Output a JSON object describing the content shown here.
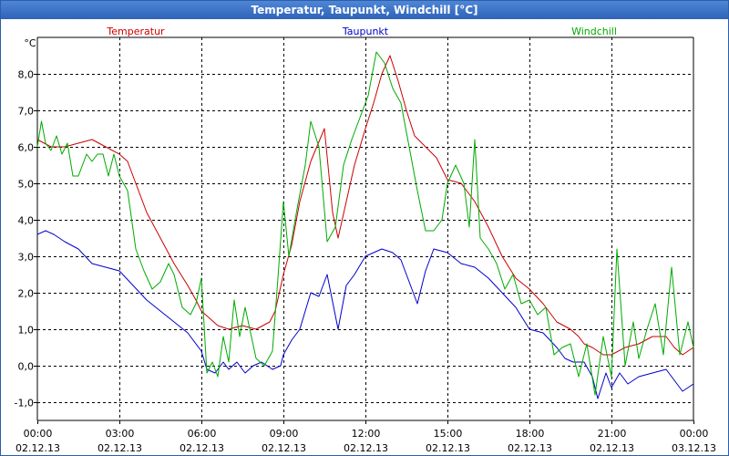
{
  "window": {
    "title": "Temperatur, Taupunkt, Windchill [°C]"
  },
  "chart_data": {
    "type": "line",
    "title": "Temperatur, Taupunkt, Windchill [°C]",
    "ylabel": "°C",
    "xlabel": "",
    "xlim_hours": [
      0,
      24
    ],
    "ylim": [
      -1.5,
      9.0
    ],
    "grid": true,
    "legend_placement": "top",
    "yticks": [
      {
        "value": 8,
        "label": "8,0"
      },
      {
        "value": 7,
        "label": "7,0"
      },
      {
        "value": 6,
        "label": "6,0"
      },
      {
        "value": 5,
        "label": "5,0"
      },
      {
        "value": 4,
        "label": "4,0"
      },
      {
        "value": 3,
        "label": "3,0"
      },
      {
        "value": 2,
        "label": "2,0"
      },
      {
        "value": 1,
        "label": "1,0"
      },
      {
        "value": 0,
        "label": "0,0"
      },
      {
        "value": -1,
        "label": "-1,0"
      }
    ],
    "xticks": [
      {
        "hour": 0,
        "time": "00:00",
        "date": "02.12.13"
      },
      {
        "hour": 3,
        "time": "03:00",
        "date": "02.12.13"
      },
      {
        "hour": 6,
        "time": "06:00",
        "date": "02.12.13"
      },
      {
        "hour": 9,
        "time": "09:00",
        "date": "02.12.13"
      },
      {
        "hour": 12,
        "time": "12:00",
        "date": "02.12.13"
      },
      {
        "hour": 15,
        "time": "15:00",
        "date": "02.12.13"
      },
      {
        "hour": 18,
        "time": "18:00",
        "date": "02.12.13"
      },
      {
        "hour": 21,
        "time": "21:00",
        "date": "02.12.13"
      },
      {
        "hour": 24,
        "time": "00:00",
        "date": "03.12.13"
      }
    ],
    "series": [
      {
        "name": "Temperatur",
        "color": "#cc0000",
        "points": [
          [
            0.0,
            6.2
          ],
          [
            0.5,
            6.0
          ],
          [
            1.0,
            6.0
          ],
          [
            1.5,
            6.1
          ],
          [
            2.0,
            6.2
          ],
          [
            2.5,
            6.0
          ],
          [
            3.0,
            5.8
          ],
          [
            3.3,
            5.6
          ],
          [
            3.6,
            5.0
          ],
          [
            4.0,
            4.2
          ],
          [
            4.5,
            3.5
          ],
          [
            5.0,
            2.8
          ],
          [
            5.5,
            2.2
          ],
          [
            5.8,
            1.8
          ],
          [
            6.0,
            1.5
          ],
          [
            6.3,
            1.3
          ],
          [
            6.6,
            1.1
          ],
          [
            7.0,
            1.0
          ],
          [
            7.5,
            1.1
          ],
          [
            8.0,
            1.0
          ],
          [
            8.5,
            1.2
          ],
          [
            8.7,
            1.5
          ],
          [
            9.0,
            2.5
          ],
          [
            9.3,
            3.3
          ],
          [
            9.6,
            4.5
          ],
          [
            10.0,
            5.6
          ],
          [
            10.5,
            6.5
          ],
          [
            10.8,
            4.2
          ],
          [
            11.0,
            3.5
          ],
          [
            11.3,
            4.5
          ],
          [
            11.6,
            5.5
          ],
          [
            12.0,
            6.5
          ],
          [
            12.3,
            7.2
          ],
          [
            12.6,
            8.0
          ],
          [
            12.9,
            8.5
          ],
          [
            13.2,
            7.8
          ],
          [
            13.5,
            7.0
          ],
          [
            13.8,
            6.3
          ],
          [
            14.2,
            6.0
          ],
          [
            14.6,
            5.7
          ],
          [
            15.0,
            5.1
          ],
          [
            15.5,
            5.0
          ],
          [
            16.0,
            4.5
          ],
          [
            16.5,
            3.8
          ],
          [
            17.0,
            3.0
          ],
          [
            17.5,
            2.4
          ],
          [
            18.0,
            2.1
          ],
          [
            18.5,
            1.7
          ],
          [
            19.0,
            1.2
          ],
          [
            19.5,
            1.0
          ],
          [
            19.8,
            0.8
          ],
          [
            20.0,
            0.6
          ],
          [
            20.3,
            0.5
          ],
          [
            20.7,
            0.3
          ],
          [
            21.0,
            0.3
          ],
          [
            21.5,
            0.5
          ],
          [
            22.0,
            0.6
          ],
          [
            22.5,
            0.8
          ],
          [
            23.0,
            0.8
          ],
          [
            23.3,
            0.5
          ],
          [
            23.6,
            0.3
          ],
          [
            24.0,
            0.5
          ]
        ]
      },
      {
        "name": "Taupunkt",
        "color": "#0000cc",
        "points": [
          [
            0.0,
            3.6
          ],
          [
            0.3,
            3.7
          ],
          [
            0.6,
            3.6
          ],
          [
            1.0,
            3.4
          ],
          [
            1.5,
            3.2
          ],
          [
            2.0,
            2.8
          ],
          [
            2.5,
            2.7
          ],
          [
            3.0,
            2.6
          ],
          [
            3.5,
            2.2
          ],
          [
            4.0,
            1.8
          ],
          [
            4.5,
            1.5
          ],
          [
            5.0,
            1.2
          ],
          [
            5.5,
            0.9
          ],
          [
            6.0,
            0.4
          ],
          [
            6.2,
            -0.1
          ],
          [
            6.5,
            -0.2
          ],
          [
            6.8,
            0.1
          ],
          [
            7.0,
            -0.1
          ],
          [
            7.3,
            0.1
          ],
          [
            7.6,
            -0.2
          ],
          [
            7.9,
            0.0
          ],
          [
            8.2,
            0.1
          ],
          [
            8.6,
            -0.1
          ],
          [
            8.9,
            0.0
          ],
          [
            9.0,
            0.3
          ],
          [
            9.3,
            0.7
          ],
          [
            9.6,
            1.0
          ],
          [
            10.0,
            2.0
          ],
          [
            10.3,
            1.9
          ],
          [
            10.6,
            2.5
          ],
          [
            11.0,
            1.0
          ],
          [
            11.3,
            2.2
          ],
          [
            11.6,
            2.5
          ],
          [
            12.0,
            3.0
          ],
          [
            12.3,
            3.1
          ],
          [
            12.6,
            3.2
          ],
          [
            13.0,
            3.1
          ],
          [
            13.3,
            2.9
          ],
          [
            13.6,
            2.3
          ],
          [
            13.9,
            1.7
          ],
          [
            14.2,
            2.6
          ],
          [
            14.5,
            3.2
          ],
          [
            15.0,
            3.1
          ],
          [
            15.5,
            2.8
          ],
          [
            16.0,
            2.7
          ],
          [
            16.5,
            2.4
          ],
          [
            17.0,
            2.0
          ],
          [
            17.5,
            1.6
          ],
          [
            18.0,
            1.0
          ],
          [
            18.5,
            0.9
          ],
          [
            19.0,
            0.5
          ],
          [
            19.3,
            0.2
          ],
          [
            19.6,
            0.1
          ],
          [
            20.0,
            0.1
          ],
          [
            20.3,
            -0.3
          ],
          [
            20.5,
            -0.9
          ],
          [
            20.8,
            -0.2
          ],
          [
            21.0,
            -0.6
          ],
          [
            21.3,
            -0.2
          ],
          [
            21.6,
            -0.5
          ],
          [
            22.0,
            -0.3
          ],
          [
            22.5,
            -0.2
          ],
          [
            23.0,
            -0.1
          ],
          [
            23.3,
            -0.4
          ],
          [
            23.6,
            -0.7
          ],
          [
            24.0,
            -0.5
          ]
        ]
      },
      {
        "name": "Windchill",
        "color": "#00aa00",
        "points": [
          [
            0.0,
            6.0
          ],
          [
            0.15,
            6.7
          ],
          [
            0.3,
            6.1
          ],
          [
            0.5,
            5.9
          ],
          [
            0.7,
            6.3
          ],
          [
            0.9,
            5.8
          ],
          [
            1.1,
            6.1
          ],
          [
            1.3,
            5.2
          ],
          [
            1.5,
            5.2
          ],
          [
            1.8,
            5.8
          ],
          [
            2.0,
            5.6
          ],
          [
            2.2,
            5.8
          ],
          [
            2.4,
            5.8
          ],
          [
            2.6,
            5.2
          ],
          [
            2.8,
            5.8
          ],
          [
            3.0,
            5.2
          ],
          [
            3.3,
            4.8
          ],
          [
            3.6,
            3.2
          ],
          [
            3.9,
            2.6
          ],
          [
            4.2,
            2.1
          ],
          [
            4.5,
            2.3
          ],
          [
            4.8,
            2.8
          ],
          [
            5.0,
            2.5
          ],
          [
            5.3,
            1.6
          ],
          [
            5.6,
            1.4
          ],
          [
            5.8,
            1.7
          ],
          [
            6.0,
            2.4
          ],
          [
            6.2,
            -0.2
          ],
          [
            6.4,
            0.1
          ],
          [
            6.6,
            -0.3
          ],
          [
            6.8,
            0.8
          ],
          [
            7.0,
            0.1
          ],
          [
            7.2,
            1.8
          ],
          [
            7.4,
            0.8
          ],
          [
            7.6,
            1.6
          ],
          [
            7.8,
            0.9
          ],
          [
            8.0,
            0.2
          ],
          [
            8.3,
            0.0
          ],
          [
            8.6,
            0.4
          ],
          [
            8.8,
            2.4
          ],
          [
            9.0,
            4.5
          ],
          [
            9.2,
            3.0
          ],
          [
            9.5,
            4.3
          ],
          [
            9.8,
            5.5
          ],
          [
            10.0,
            6.7
          ],
          [
            10.3,
            6.0
          ],
          [
            10.6,
            3.4
          ],
          [
            10.9,
            3.8
          ],
          [
            11.2,
            5.5
          ],
          [
            11.5,
            6.2
          ],
          [
            11.8,
            6.8
          ],
          [
            12.1,
            7.4
          ],
          [
            12.4,
            8.6
          ],
          [
            12.7,
            8.3
          ],
          [
            13.0,
            7.6
          ],
          [
            13.3,
            7.2
          ],
          [
            13.6,
            6.0
          ],
          [
            13.9,
            4.8
          ],
          [
            14.2,
            3.7
          ],
          [
            14.5,
            3.7
          ],
          [
            14.8,
            4.0
          ],
          [
            15.0,
            5.0
          ],
          [
            15.3,
            5.5
          ],
          [
            15.6,
            5.0
          ],
          [
            15.8,
            3.8
          ],
          [
            16.0,
            6.2
          ],
          [
            16.2,
            3.5
          ],
          [
            16.5,
            3.2
          ],
          [
            16.8,
            2.8
          ],
          [
            17.1,
            2.1
          ],
          [
            17.4,
            2.5
          ],
          [
            17.7,
            1.7
          ],
          [
            18.0,
            1.8
          ],
          [
            18.3,
            1.4
          ],
          [
            18.6,
            1.6
          ],
          [
            18.9,
            0.3
          ],
          [
            19.2,
            0.5
          ],
          [
            19.5,
            0.6
          ],
          [
            19.8,
            -0.3
          ],
          [
            20.1,
            0.6
          ],
          [
            20.4,
            -0.8
          ],
          [
            20.7,
            0.8
          ],
          [
            21.0,
            -0.3
          ],
          [
            21.2,
            3.2
          ],
          [
            21.5,
            0.0
          ],
          [
            21.8,
            1.2
          ],
          [
            22.0,
            0.2
          ],
          [
            22.3,
            1.0
          ],
          [
            22.6,
            1.7
          ],
          [
            22.9,
            0.3
          ],
          [
            23.2,
            2.7
          ],
          [
            23.5,
            0.3
          ],
          [
            23.8,
            1.2
          ],
          [
            24.0,
            0.5
          ]
        ]
      }
    ]
  }
}
